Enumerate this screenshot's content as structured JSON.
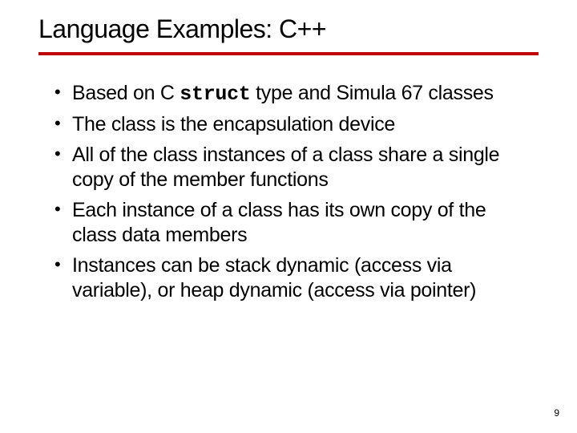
{
  "title": "Language Examples: C++",
  "bullets": [
    {
      "pre": "Based on C ",
      "code": "struct",
      "post": " type and Simula 67 classes"
    },
    {
      "pre": "The class is the encapsulation device",
      "code": "",
      "post": ""
    },
    {
      "pre": "All of the class instances of a class share a single copy of the member functions",
      "code": "",
      "post": ""
    },
    {
      "pre": "Each instance of a class has its own copy of the class data members",
      "code": "",
      "post": ""
    },
    {
      "pre": "Instances can be stack dynamic (access via variable), or heap dynamic (access via pointer)",
      "code": "",
      "post": ""
    }
  ],
  "page_number": "9"
}
